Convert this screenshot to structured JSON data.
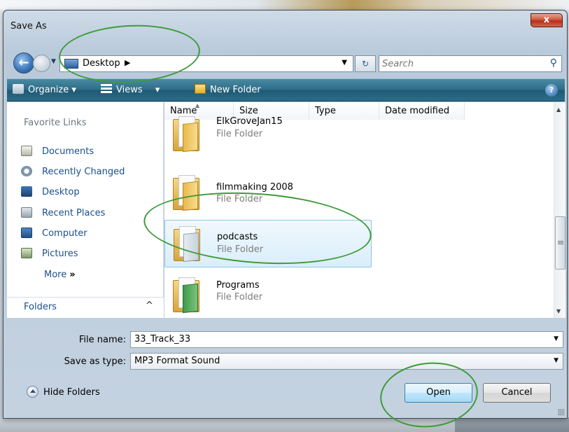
{
  "dialog": {
    "title": "Save As",
    "close_label": "x"
  },
  "navigation": {
    "back_arrow": "←",
    "location": "Desktop",
    "location_chevron": "▶",
    "dropdown_arrow": "▼",
    "refresh_glyph": "↻",
    "search_placeholder": "Search"
  },
  "command_bar": {
    "organize": "Organize",
    "views": "Views",
    "new_folder": "New Folder",
    "help": "?",
    "menu_arrow": "▾"
  },
  "nav_pane": {
    "heading": "Favorite Links",
    "items": [
      {
        "label": "Documents",
        "icon": "documents-icon"
      },
      {
        "label": "Recently Changed",
        "icon": "recently-changed-icon"
      },
      {
        "label": "Desktop",
        "icon": "desktop-icon"
      },
      {
        "label": "Recent Places",
        "icon": "recent-places-icon"
      },
      {
        "label": "Computer",
        "icon": "computer-icon"
      },
      {
        "label": "Pictures",
        "icon": "pictures-icon"
      }
    ],
    "more_label": "More",
    "more_arrows": "»",
    "folders_label": "Folders",
    "folders_caret": "^"
  },
  "file_list": {
    "columns": [
      "Name",
      "Size",
      "Type",
      "Date modified"
    ],
    "sort_glyph": "▲",
    "files": [
      {
        "name": "ElkGroveJan15",
        "type": "File Folder",
        "selected": false
      },
      {
        "name": "filmmaking 2008",
        "type": "File Folder",
        "selected": false
      },
      {
        "name": "podcasts",
        "type": "File Folder",
        "selected": true
      },
      {
        "name": "Programs",
        "type": "File Folder",
        "selected": false
      }
    ]
  },
  "form": {
    "file_name_label": "File name:",
    "file_name_value": "33_Track_33",
    "save_type_label": "Save as type:",
    "save_type_value": "MP3 Format Sound"
  },
  "footer": {
    "hide_folders": "Hide Folders",
    "open_button": "Open",
    "cancel_button": "Cancel"
  },
  "colors": {
    "annotation": "#3d9b3a",
    "command_bar": "#2d6b86",
    "link": "#1a4f8d"
  }
}
